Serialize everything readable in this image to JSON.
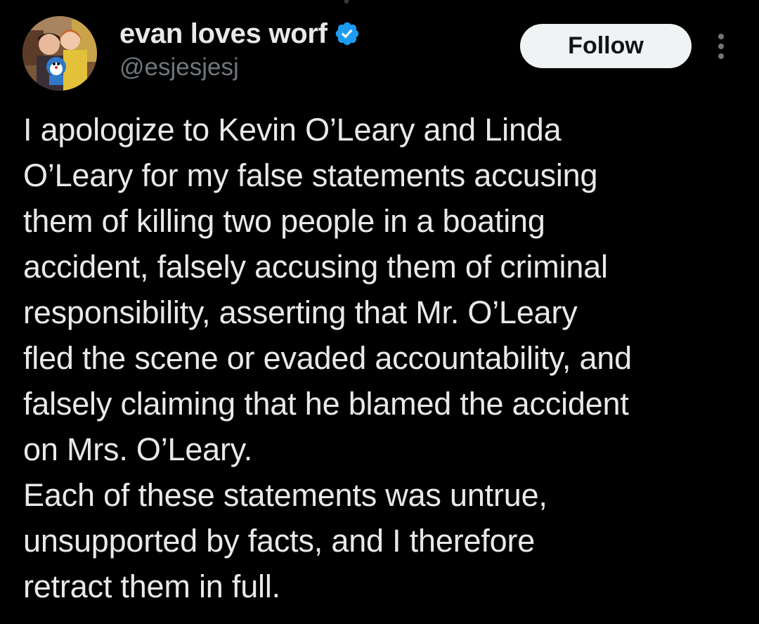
{
  "author": {
    "display_name": "evan loves worf",
    "handle": "@esjesjesj",
    "verified": true,
    "avatar_icon": "profile-photo"
  },
  "actions": {
    "follow_label": "Follow",
    "more_icon": "more-vertical-icon"
  },
  "tweet": {
    "lines": [
      "I apologize to Kevin O’Leary and Linda",
      "O’Leary for my false statements accusing",
      "them of killing two people in a boating",
      "accident, falsely accusing them of criminal",
      "responsibility, asserting that Mr. O’Leary",
      "fled the scene or evaded accountability, and",
      "falsely claiming that he blamed the accident",
      "on Mrs. O’Leary.",
      "Each of these statements was untrue,",
      "unsupported by facts, and I therefore",
      "retract them in full."
    ]
  },
  "colors": {
    "background": "#000000",
    "text_primary": "#e7e9ea",
    "text_secondary": "#71767b",
    "verified_badge": "#1d9bf0",
    "follow_bg": "#eff3f4",
    "follow_text": "#0f1419"
  }
}
